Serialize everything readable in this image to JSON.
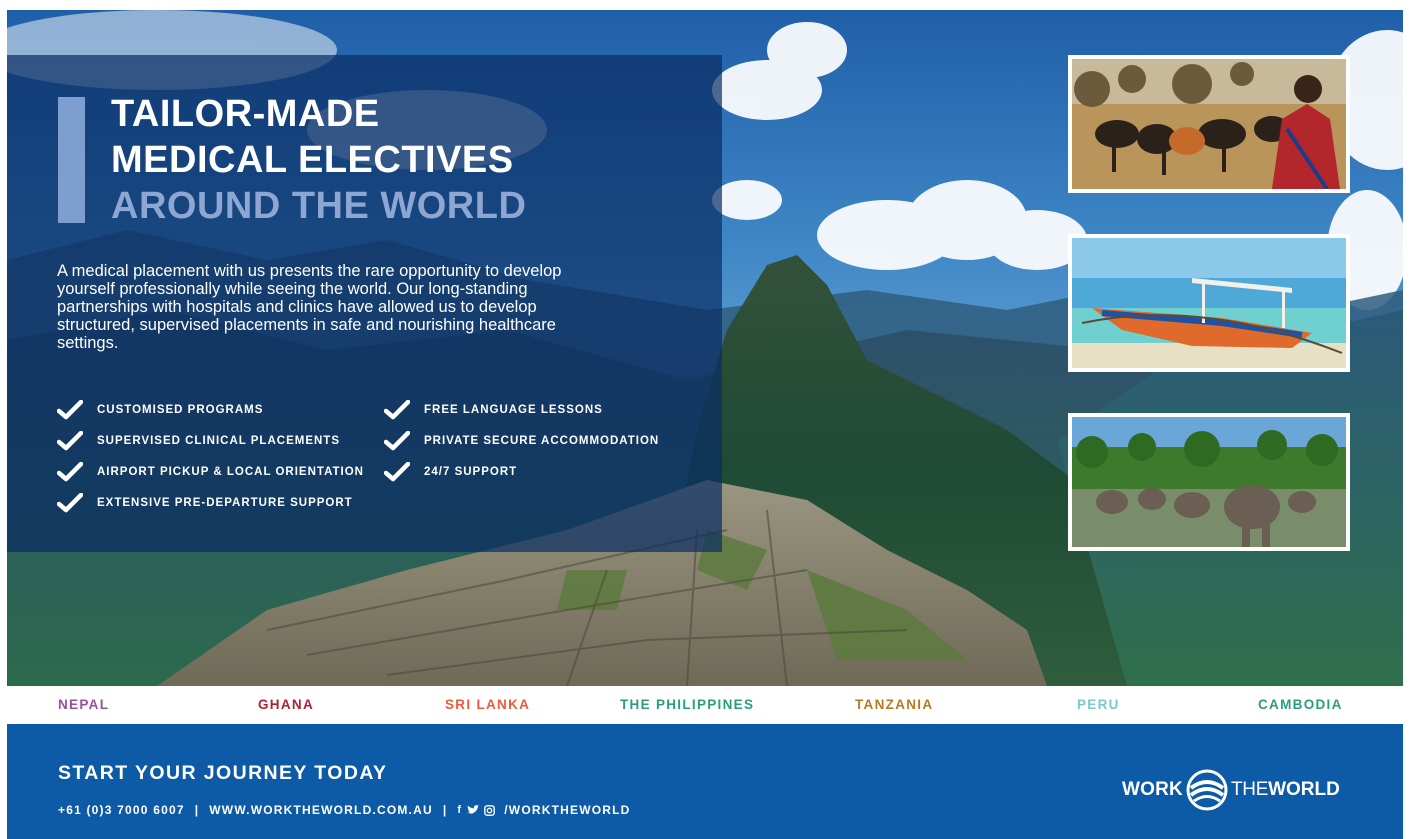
{
  "headline": {
    "line1": "TAILOR-MADE",
    "line2": "MEDICAL ELECTIVES",
    "line3": "AROUND THE WORLD"
  },
  "intro": "A medical placement with us presents the rare opportunity to develop yourself professionally while seeing the world. Our long-standing partnerships with hospitals and clinics have allowed us to develop structured, supervised placements in safe and nourishing healthcare settings.",
  "features": {
    "left": [
      "CUSTOMISED PROGRAMS",
      "SUPERVISED CLINICAL PLACEMENTS",
      "AIRPORT PICKUP & LOCAL ORIENTATION",
      "EXTENSIVE PRE-DEPARTURE SUPPORT"
    ],
    "right": [
      "FREE LANGUAGE LESSONS",
      "PRIVATE SECURE ACCOMMODATION",
      "24/7 SUPPORT"
    ]
  },
  "countries": [
    {
      "name": "NEPAL",
      "color": "#9a4f9b"
    },
    {
      "name": "GHANA",
      "color": "#b21f34"
    },
    {
      "name": "SRI LANKA",
      "color": "#ee5a3a"
    },
    {
      "name": "THE PHILIPPINES",
      "color": "#2a9d7c"
    },
    {
      "name": "TANZANIA",
      "color": "#b87a1e"
    },
    {
      "name": "PERU",
      "color": "#7cc8cf"
    },
    {
      "name": "CAMBODIA",
      "color": "#2a9d7c"
    }
  ],
  "footer": {
    "cta": "START YOUR JOURNEY TODAY",
    "phone": "+61 (0)3 7000 6007",
    "separator": "|",
    "website": "WWW.WORKTHEWORLD.COM.AU",
    "social_handle": "/WORKTHEWORLD",
    "social_icons": [
      "facebook-icon",
      "twitter-icon",
      "instagram-icon"
    ]
  },
  "logo": {
    "word1": "WORK",
    "word2": "THE",
    "word3": "WORLD"
  },
  "colors": {
    "footer_bg": "#0d5aa7",
    "accent_bar": "#7f9ed0",
    "headline_accent": "#8ea6d2"
  }
}
